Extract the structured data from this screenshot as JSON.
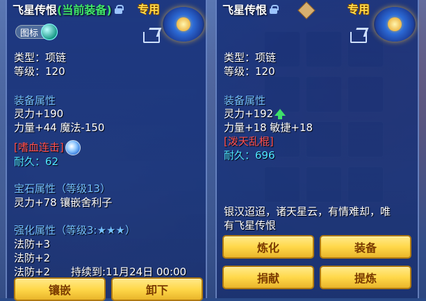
{
  "left": {
    "name": "飞星传恨",
    "equipped_tag": "(当前装备)",
    "special": "专用",
    "tag_button": "图标",
    "type_line": "类型：项链",
    "level_line": "等级：120",
    "attr_header": "装备属性",
    "attr_1": "灵力+190",
    "attr_2": "力量+44 魔法-150",
    "skill": "[嗜血连击]",
    "durability": "耐久：62",
    "gem_header": "宝石属性（等级13）",
    "gem_line": "灵力+78 镶嵌舍利子",
    "enhance_header": "强化属性（等级3:★★★）",
    "enh_1": "法防+3",
    "enh_2": "法防+2",
    "enh_3": "法防+2",
    "enh_3_time": "持续到:11月24日 00:00",
    "btn_inlay": "镶嵌",
    "btn_unequip": "卸下"
  },
  "right": {
    "name": "飞星传恨",
    "special": "专用",
    "type_line": "类型：项链",
    "level_line": "等级：120",
    "attr_header": "装备属性",
    "attr_1": "灵力+192",
    "attr_2": "力量+18 敏捷+18",
    "skill": "[泼天乱棍]",
    "durability": "耐久：696",
    "desc_1": "银汉迢迢，诸天星云，有情难却，唯",
    "desc_2": "有飞星传恨",
    "btn_refine": "炼化",
    "btn_equip": "装备",
    "btn_donate": "捐献",
    "btn_extract": "提炼"
  }
}
